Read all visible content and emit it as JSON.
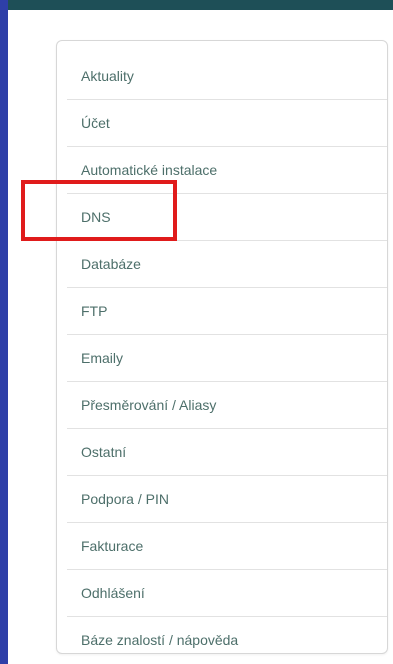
{
  "colors": {
    "topbar": "#1e4f57",
    "left_border": "#2e3fa8",
    "menu_text": "#4d6f6a",
    "highlight": "#e01b1b"
  },
  "menu": {
    "items": [
      {
        "label": "Aktuality"
      },
      {
        "label": "Účet"
      },
      {
        "label": "Automatické instalace"
      },
      {
        "label": "DNS",
        "highlighted": true
      },
      {
        "label": "Databáze"
      },
      {
        "label": "FTP"
      },
      {
        "label": "Emaily"
      },
      {
        "label": "Přesměrování / Aliasy"
      },
      {
        "label": "Ostatní"
      },
      {
        "label": "Podpora / PIN"
      },
      {
        "label": "Fakturace"
      },
      {
        "label": "Odhlášení"
      },
      {
        "label": "Báze znalostí / nápověda"
      }
    ]
  }
}
